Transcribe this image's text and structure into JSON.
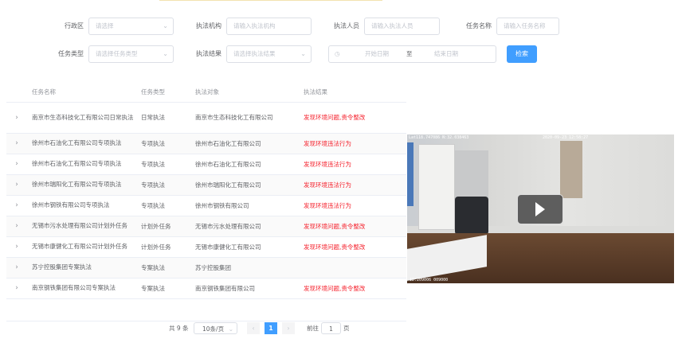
{
  "filters": {
    "region": {
      "label": "行政区",
      "placeholder": "请选择"
    },
    "agency": {
      "label": "执法机构",
      "placeholder": "请输入执法机构"
    },
    "officer": {
      "label": "执法人员",
      "placeholder": "请输入执法人员"
    },
    "task_name": {
      "label": "任务名称",
      "placeholder": "请输入任务名称"
    },
    "task_type": {
      "label": "任务类型",
      "placeholder": "请选择任务类型"
    },
    "result": {
      "label": "执法结果",
      "placeholder": "请选择执法结果"
    },
    "date_range": {
      "start": "开始日期",
      "separator": "至",
      "end": "结束日期"
    },
    "search_label": "检索"
  },
  "table": {
    "headers": [
      "任务名称",
      "任务类型",
      "执法对象",
      "执法结果"
    ],
    "rows": [
      {
        "name": "南京市生态科技化工有限公司日常执法",
        "type": "日常执法",
        "target": "南京市生态科技化工有限公司",
        "result": "发现环境问题,责令整改"
      },
      {
        "name": "徐州市石油化工有限公司专项执法",
        "type": "专项执法",
        "target": "徐州市石油化工有限公司",
        "result": "发现环境违法行为"
      },
      {
        "name": "徐州市石油化工有限公司专项执法",
        "type": "专项执法",
        "target": "徐州市石油化工有限公司",
        "result": "发现环境违法行为"
      },
      {
        "name": "徐州市瑞阳化工有限公司专项执法",
        "type": "专项执法",
        "target": "徐州市瑞阳化工有限公司",
        "result": "发现环境违法行为"
      },
      {
        "name": "徐州市钢铁有限公司专项执法",
        "type": "专项执法",
        "target": "徐州市钢铁有限公司",
        "result": "发现环境违法行为"
      },
      {
        "name": "无锡市污水处理有限公司计划外任务",
        "type": "计划外任务",
        "target": "无锡市污水处理有限公司",
        "result": "发现环境问题,责令整改"
      },
      {
        "name": "无锡市康健化工有限公司计划外任务",
        "type": "计划外任务",
        "target": "无锡市康健化工有限公司",
        "result": "发现环境问题,责令整改"
      },
      {
        "name": "苏宁控股集团专案执法",
        "type": "专案执法",
        "target": "苏宁控股集团",
        "result": ""
      },
      {
        "name": "南京钢铁集团有限公司专案执法",
        "type": "专案执法",
        "target": "南京钢铁集团有限公司",
        "result": "发现环境问题,责令整改"
      }
    ]
  },
  "pagination": {
    "total": "共 9 条",
    "page_size": "10条/页",
    "current": "1",
    "goto_label": "前往",
    "goto_value": "1",
    "page_suffix": "页"
  },
  "video": {
    "overlay_top_left": "Lat118.747086 N:32.038463",
    "overlay_top_right": "2020-09-23 12:58:27",
    "overlay_bottom": "ID:209006 009000"
  },
  "colors": {
    "primary": "#409eff",
    "danger": "#f5222d"
  }
}
